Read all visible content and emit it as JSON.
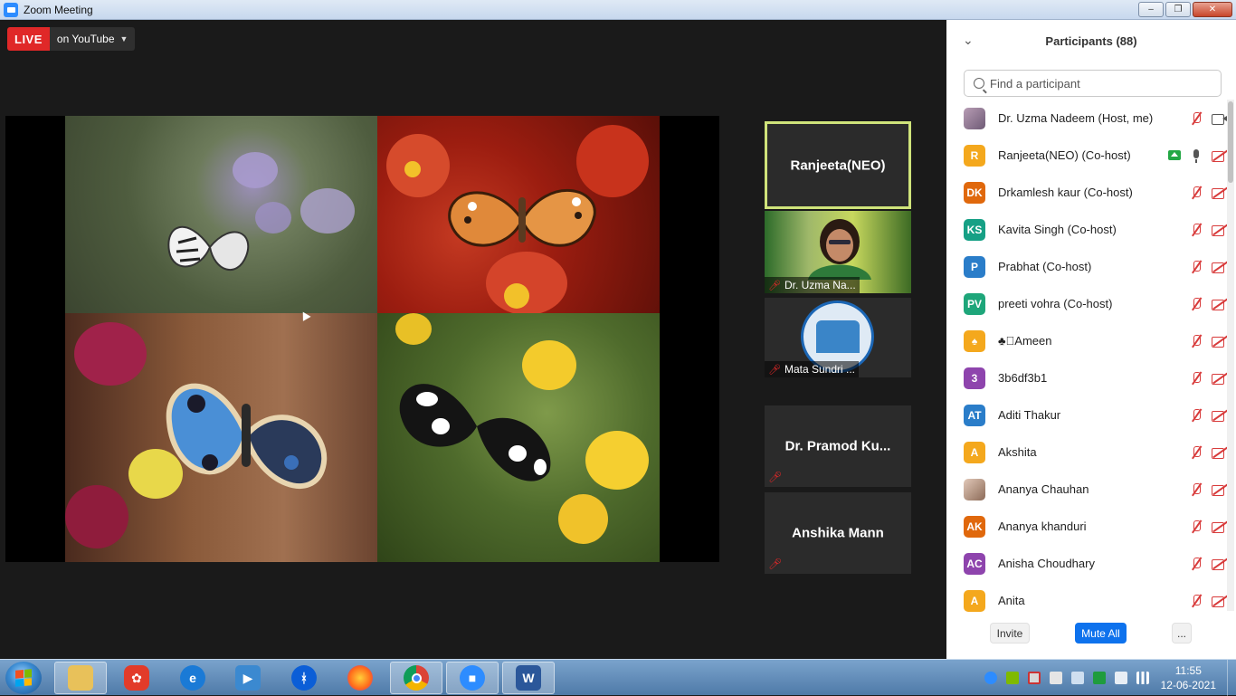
{
  "window": {
    "title": "Zoom Meeting"
  },
  "live": {
    "badge": "LIVE",
    "destination": "on YouTube"
  },
  "video_strip": {
    "tiles": [
      {
        "name": "Ranjeeta(NEO)"
      },
      {
        "name": "Dr. Uzma Na..."
      },
      {
        "name": "Mata Sundri ..."
      },
      {
        "name": "Dr. Pramod Ku..."
      },
      {
        "name": "Anshika Mann"
      }
    ]
  },
  "panel": {
    "title": "Participants (88)",
    "search_placeholder": "Find a participant",
    "participants": [
      {
        "name": "Dr. Uzma Nadeem (Host, me)",
        "initials": "",
        "color": "#7a6a8a",
        "mic": "off",
        "cam": "on",
        "sharing": false
      },
      {
        "name": "Ranjeeta(NEO) (Co-host)",
        "initials": "R",
        "color": "#f4a81d",
        "mic": "on",
        "cam": "off",
        "sharing": true
      },
      {
        "name": "Drkamlesh kaur (Co-host)",
        "initials": "DK",
        "color": "#e0680c",
        "mic": "off",
        "cam": "off",
        "sharing": false
      },
      {
        "name": "Kavita Singh (Co-host)",
        "initials": "KS",
        "color": "#16a085",
        "mic": "off",
        "cam": "off",
        "sharing": false
      },
      {
        "name": "Prabhat (Co-host)",
        "initials": "P",
        "color": "#2a7dc9",
        "mic": "off",
        "cam": "off",
        "sharing": false
      },
      {
        "name": "preeti vohra (Co-host)",
        "initials": "PV",
        "color": "#1ea67a",
        "mic": "off",
        "cam": "off",
        "sharing": false
      },
      {
        "name": "♣􀀀Ameen",
        "initials": "♠",
        "color": "#f4a81d",
        "mic": "off",
        "cam": "off",
        "sharing": false
      },
      {
        "name": "3b6df3b1",
        "initials": "3",
        "color": "#8e44ad",
        "mic": "off",
        "cam": "off",
        "sharing": false
      },
      {
        "name": "Aditi Thakur",
        "initials": "AT",
        "color": "#2a7dc9",
        "mic": "off",
        "cam": "off",
        "sharing": false
      },
      {
        "name": "Akshita",
        "initials": "A",
        "color": "#f4a81d",
        "mic": "off",
        "cam": "off",
        "sharing": false
      },
      {
        "name": "Ananya Chauhan",
        "initials": "",
        "color": "#b08f80",
        "mic": "off",
        "cam": "off",
        "sharing": false
      },
      {
        "name": "Ananya khanduri",
        "initials": "AK",
        "color": "#e0680c",
        "mic": "off",
        "cam": "off",
        "sharing": false
      },
      {
        "name": "Anisha Choudhary",
        "initials": "AC",
        "color": "#8e44ad",
        "mic": "off",
        "cam": "off",
        "sharing": false
      },
      {
        "name": "Anita",
        "initials": "A",
        "color": "#f4a81d",
        "mic": "off",
        "cam": "off",
        "sharing": false
      }
    ],
    "buttons": {
      "invite": "Invite",
      "mute_all": "Mute All",
      "more": "..."
    }
  },
  "taskbar": {
    "apps": [
      "file-explorer",
      "pdf-app",
      "internet-explorer",
      "media-player",
      "bluetooth",
      "firefox",
      "chrome",
      "zoom",
      "word"
    ],
    "clock": {
      "time": "11:55",
      "date": "12-06-2021"
    }
  }
}
